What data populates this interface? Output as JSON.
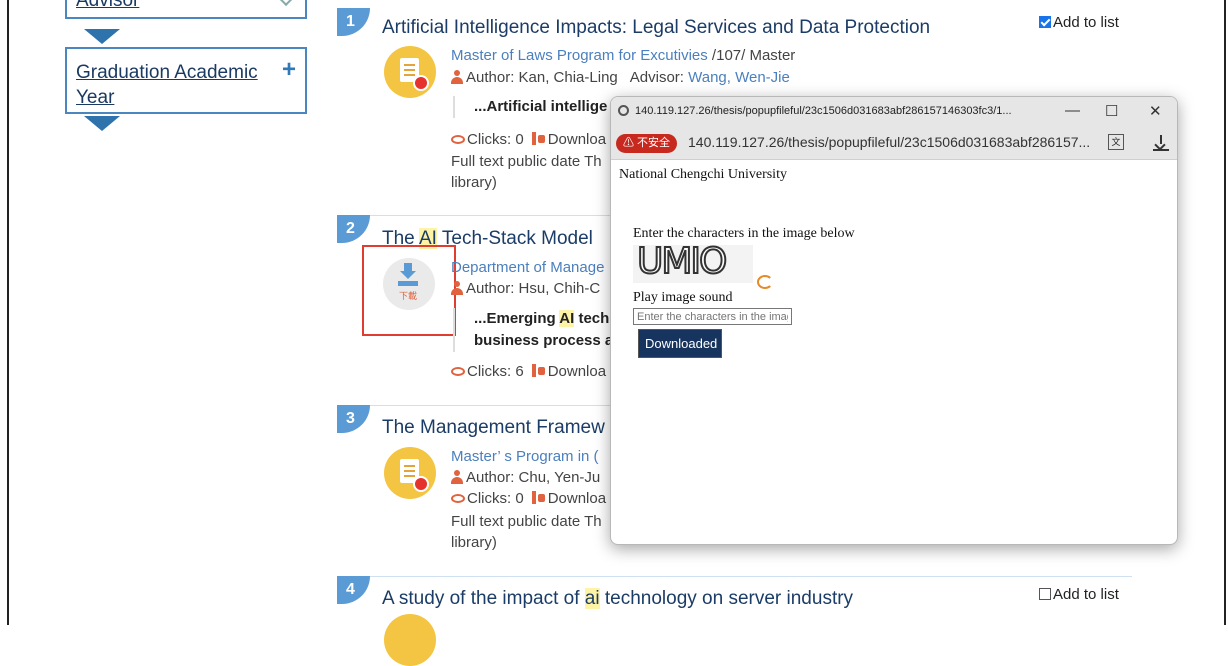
{
  "sidebar": {
    "advisor_label": "Advisor",
    "year_label": "Graduation Academic Year",
    "year_icon": "plus-icon"
  },
  "results": [
    {
      "number": "1",
      "title": "Artificial Intelligence Impacts: Legal Services and Data Protection",
      "program_link": "Master of Laws Program for Excutivies",
      "program_rest": " /107/ Master",
      "author_label": "Author: Kan, Chia-Ling",
      "advisor_label": "Advisor: ",
      "advisor_name": "Wang, Wen-Jie",
      "abstract_line": "...Artificial intellige",
      "clicks": "Clicks: 0",
      "download": "Downloa",
      "fulltext_line1": "Full text public date Th",
      "fulltext_line2": "library)",
      "add_to_list": "Add to list",
      "checked": true
    },
    {
      "number": "2",
      "title_pre": "The ",
      "title_hl": "AI",
      "title_post": " Tech-Stack Model",
      "program_link": "Department of Manage",
      "author_label": "Author: Hsu, Chih-C",
      "abstract_pre": "...Emerging ",
      "abstract_hl": "AI",
      "abstract_post": " tech",
      "abstract_line2": "business process a",
      "clicks": "Clicks: 6",
      "download": "Downloa",
      "download_icon_text": "下載"
    },
    {
      "number": "3",
      "title": "The Management Framew",
      "program_link": "Master’ s Program in (",
      "author_label": "Author: Chu, Yen-Ju",
      "clicks": "Clicks: 0",
      "download": "Downloa",
      "fulltext_line1": "Full text public date Th",
      "fulltext_line2": "library)"
    },
    {
      "number": "4",
      "title_pre": "A study of the impact of ",
      "title_hl": "ai",
      "title_post": " technology on server industry",
      "add_to_list": "Add to list",
      "checked": false
    }
  ],
  "popup": {
    "window_title": "140.119.127.26/thesis/popupfileful/23c1506d031683abf286157146303fc3/1...",
    "insecure_label": "⚠ 不安全",
    "url": "140.119.127.26/thesis/popupfileful/23c1506d031683abf286157...",
    "university": "National Chengchi University",
    "instruction": "Enter the characters in the image below",
    "captcha_text": "UMIO",
    "play_sound": "Play image sound",
    "input_placeholder": "Enter the characters in the image",
    "submit_label": "Downloaded",
    "minimize": "—",
    "maximize": "☐",
    "close": "✕"
  },
  "colors": {
    "accent": "#5b9bd5",
    "title": "#1b3c66",
    "link": "#4b7fbd",
    "icon_orange": "#e0623e",
    "insecure": "#c8291f",
    "button": "#17345f",
    "highlight_box": "#e03d32"
  }
}
